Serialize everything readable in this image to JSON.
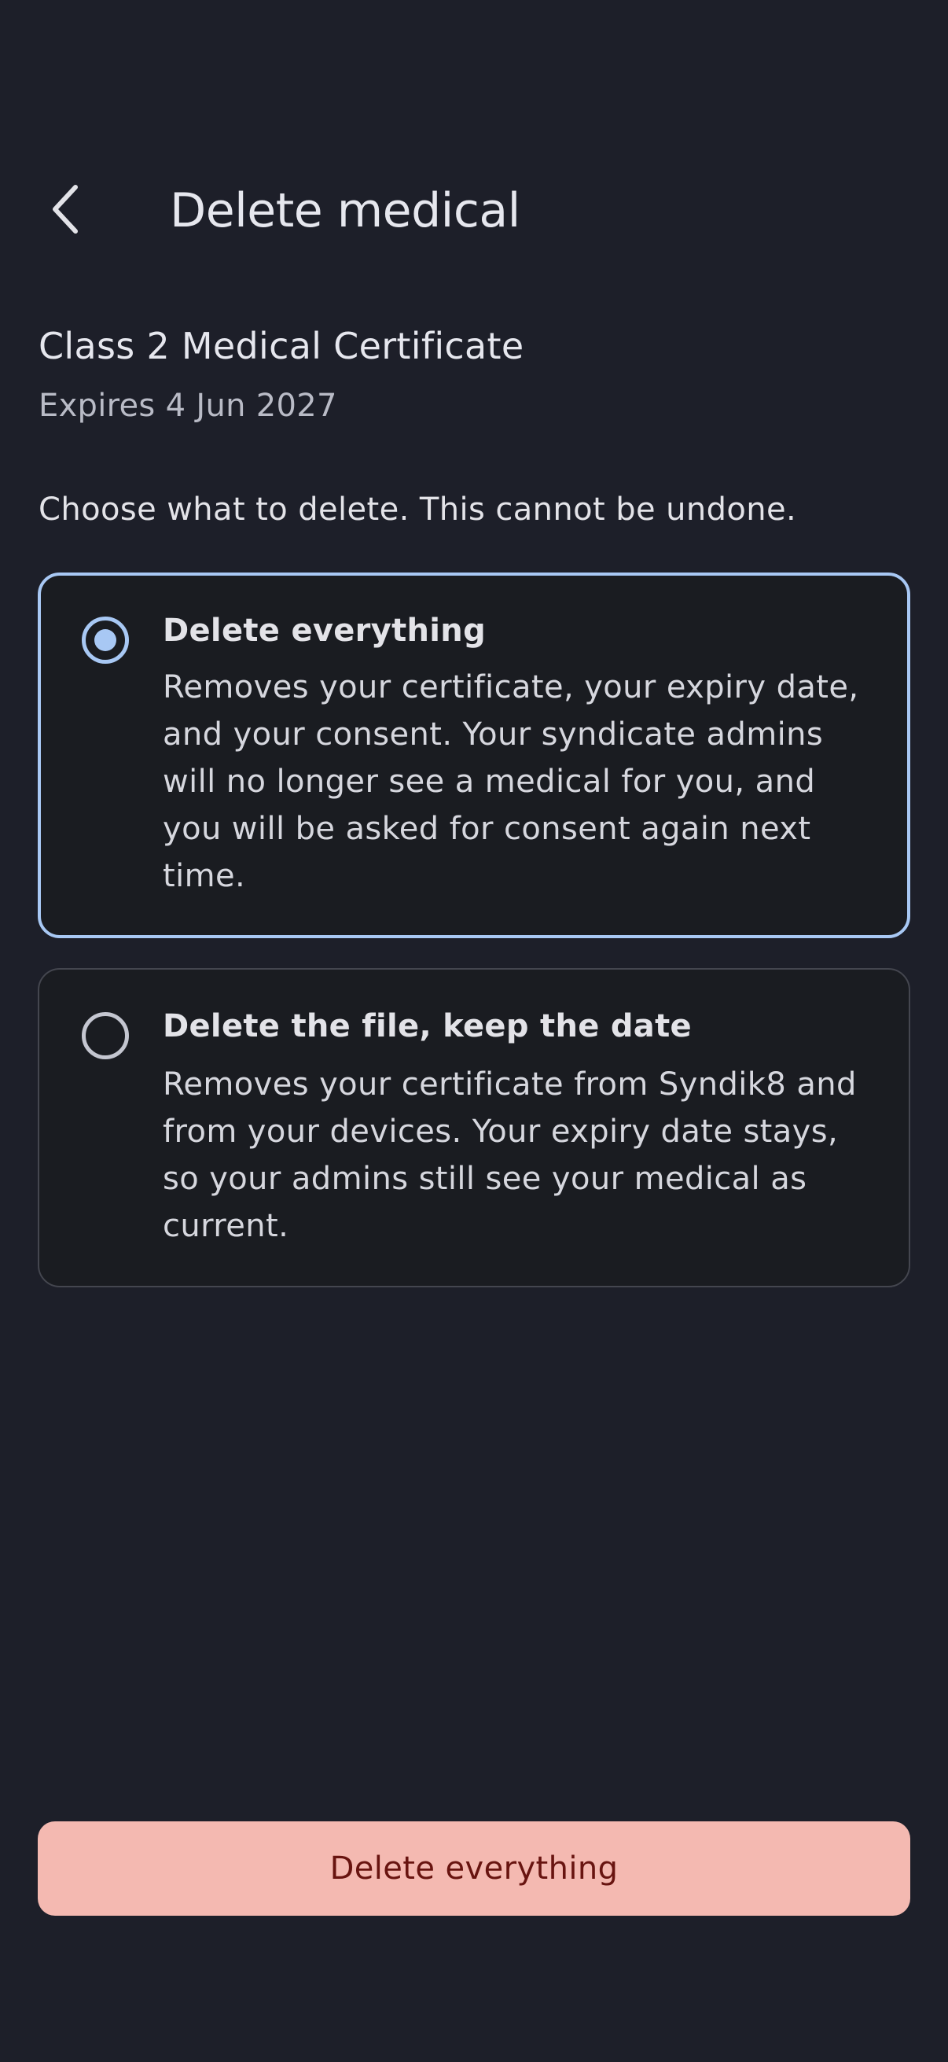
{
  "header": {
    "title": "Delete medical",
    "back_icon": "chevron-left-icon"
  },
  "certificate": {
    "name": "Class 2 Medical Certificate",
    "expiry": "Expires 4 Jun 2027"
  },
  "instruction": "Choose what to delete. This cannot be undone.",
  "options": [
    {
      "title": "Delete everything",
      "description": "Removes your certificate, your expiry date, and your consent. Your syndicate admins will no longer see a medical for you, and you will be asked for consent again next time.",
      "selected": true
    },
    {
      "title": "Delete the file, keep the date",
      "description": "Removes your certificate from Syndik8 and from your devices. Your expiry date stays, so your admins still see your medical as current.",
      "selected": false
    }
  ],
  "action": {
    "label": "Delete everything"
  },
  "colors": {
    "background": "#1d1f29",
    "card": "#1a1c21",
    "accent": "#a8c8f4",
    "danger_button": "#f4b9b1",
    "danger_text": "#681410"
  }
}
